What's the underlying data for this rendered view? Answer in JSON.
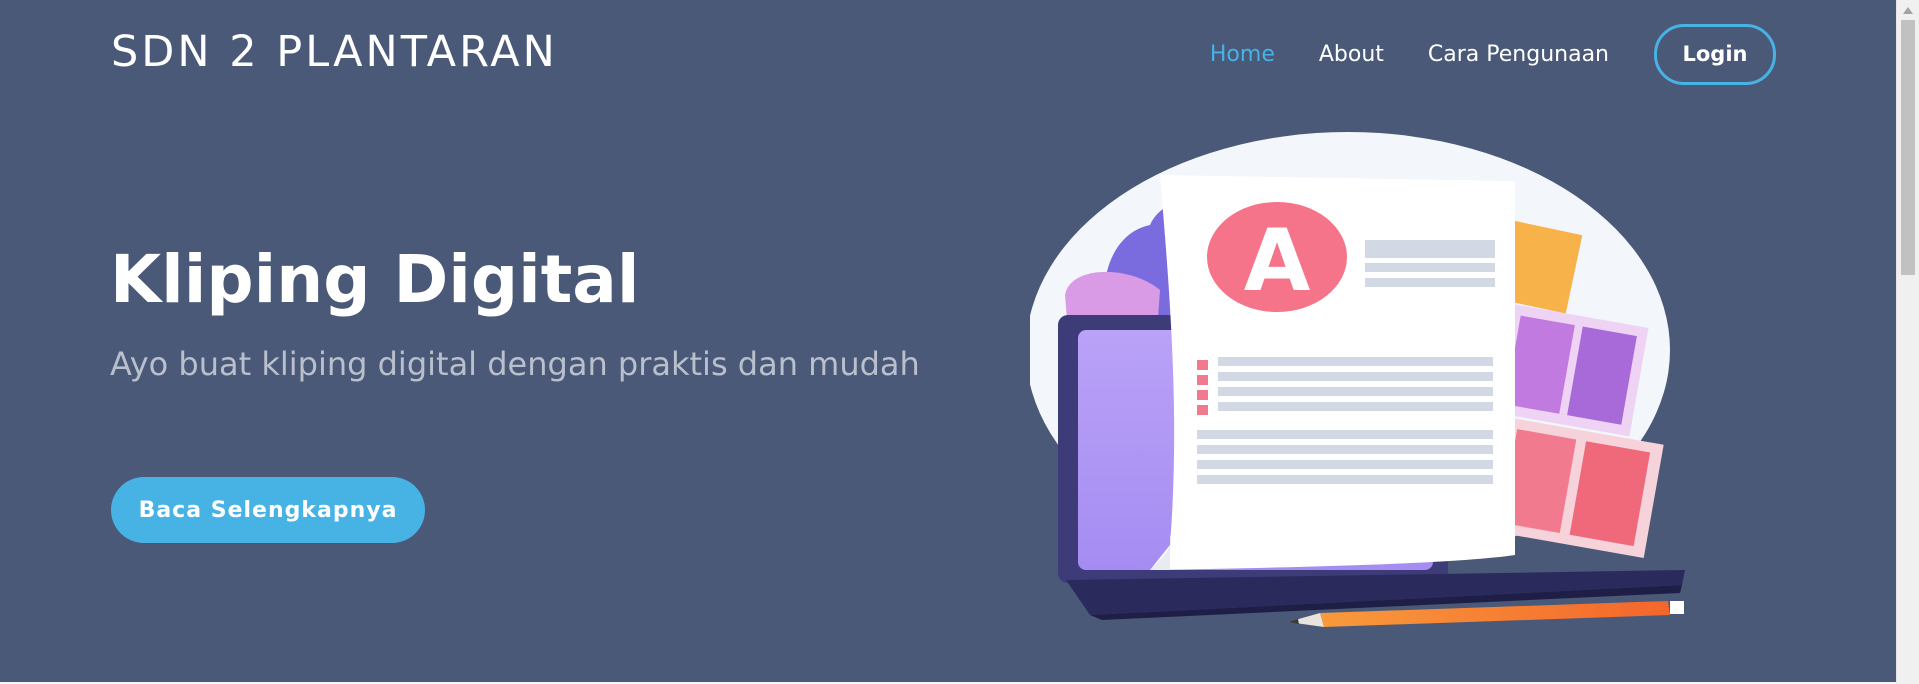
{
  "header": {
    "brand": "SDN 2 PLANTARAN",
    "nav": [
      {
        "label": "Home",
        "active": true
      },
      {
        "label": "About",
        "active": false
      },
      {
        "label": "Cara Pengunaan",
        "active": false
      }
    ],
    "login_label": "Login"
  },
  "hero": {
    "title": "Kliping Digital",
    "subtitle": "Ayo buat kliping digital dengan praktis dan mudah",
    "cta_label": "Baca Selengkapnya",
    "illustration_letter": "A"
  },
  "colors": {
    "background": "#4a5977",
    "accent": "#47b2e4",
    "subtitle": "#b9bfcc",
    "text": "#ffffff"
  }
}
